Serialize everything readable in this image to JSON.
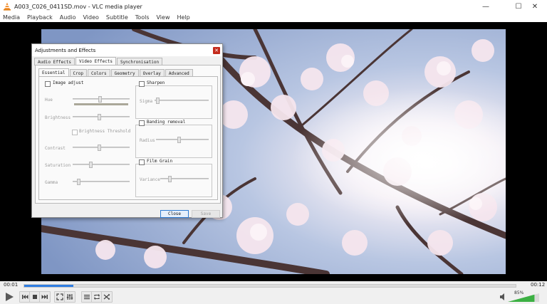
{
  "window": {
    "title": "A003_C026_0411SD.mov - VLC media player"
  },
  "menu": [
    "Media",
    "Playback",
    "Audio",
    "Video",
    "Subtitle",
    "Tools",
    "View",
    "Help"
  ],
  "player": {
    "elapsed": "00:01",
    "total": "00:12",
    "progress_fraction": 0.1,
    "volume": "85%",
    "volume_fraction": 0.85
  },
  "dialog": {
    "title": "Adjustments and Effects",
    "tabs": [
      "Audio Effects",
      "Video Effects",
      "Synchronisation"
    ],
    "active_tab": "Video Effects",
    "subtabs": [
      "Essential",
      "Crop",
      "Colors",
      "Geometry",
      "Overlay",
      "Advanced"
    ],
    "active_subtab": "Essential",
    "image_adjust": {
      "label": "Image adjust",
      "hue": "Hue",
      "brightness": "Brightness",
      "brightness_threshold": "Brightness Threshold",
      "contrast": "Contrast",
      "saturation": "Saturation",
      "gamma": "Gamma"
    },
    "sharpen": {
      "label": "Sharpen",
      "sigma": "Sigma"
    },
    "banding": {
      "label": "Banding removal",
      "radius": "Radius"
    },
    "film_grain": {
      "label": "Film Grain",
      "variance": "Variance"
    },
    "buttons": {
      "close": "Close",
      "save": "Save"
    }
  },
  "colors": {
    "accent": "#2f7de1",
    "close_red": "#c42b1c",
    "volume_green": "#3cb043"
  }
}
